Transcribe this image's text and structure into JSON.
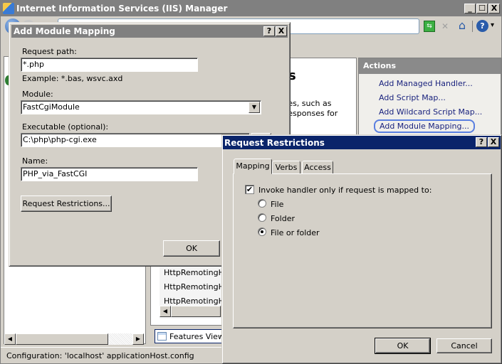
{
  "main_window": {
    "title": "Internet Information Services (IIS) Manager",
    "controls": {
      "minimize": "_",
      "maximize": "☐",
      "close": "X"
    },
    "toolbar_icons": [
      "refresh-icon",
      "stop-icon",
      "home-icon",
      "help-icon"
    ],
    "help_dropdown": "▾"
  },
  "handler_panel": {
    "heading_fragment": "s",
    "desc_line1": "tes, such as",
    "desc_line2": "responses for",
    "list_items": [
      "HttpRemotingHar",
      "HttpRemotingHar",
      "HttpRemotingHar",
      "HttpRemotingHar"
    ],
    "features_view_label": "Features View"
  },
  "actions": {
    "header": "Actions",
    "items": [
      {
        "label": "Add Managed Handler..."
      },
      {
        "label": "Add Script Map..."
      },
      {
        "label": "Add Wildcard Script Map..."
      },
      {
        "label": "Add Module Mapping...",
        "focused": true
      }
    ]
  },
  "status_bar": {
    "text": "Configuration: 'localhost' applicationHost.config"
  },
  "add_module_mapping": {
    "title": "Add Module Mapping",
    "help_btn": "?",
    "close_btn": "X",
    "request_path_label": "Request path:",
    "request_path_value": "*.php",
    "example_text": "Example: *.bas, wsvc.axd",
    "module_label": "Module:",
    "module_value": "FastCgiModule",
    "executable_label": "Executable (optional):",
    "executable_value": "C:\\php\\php-cgi.exe",
    "name_label": "Name:",
    "name_value": "PHP_via_FastCGI",
    "request_restrictions_button": "Request Restrictions...",
    "ok_button": "OK"
  },
  "request_restrictions": {
    "title": "Request Restrictions",
    "help_btn": "?",
    "close_btn": "X",
    "tabs": [
      {
        "label": "Mapping",
        "active": true
      },
      {
        "label": "Verbs",
        "active": false
      },
      {
        "label": "Access",
        "active": false
      }
    ],
    "invoke_checkbox_label": "Invoke handler only if request is mapped to:",
    "invoke_checked": true,
    "radio_options": [
      {
        "label": "File",
        "selected": false
      },
      {
        "label": "Folder",
        "selected": false
      },
      {
        "label": "File or folder",
        "selected": true
      }
    ],
    "ok_button": "OK",
    "cancel_button": "Cancel"
  },
  "colors": {
    "active_title": "#0a246a",
    "inactive_title": "#808080",
    "dialog_face": "#d4d0c8",
    "link": "#1a237e",
    "focus_ring": "#3b6fd8"
  }
}
